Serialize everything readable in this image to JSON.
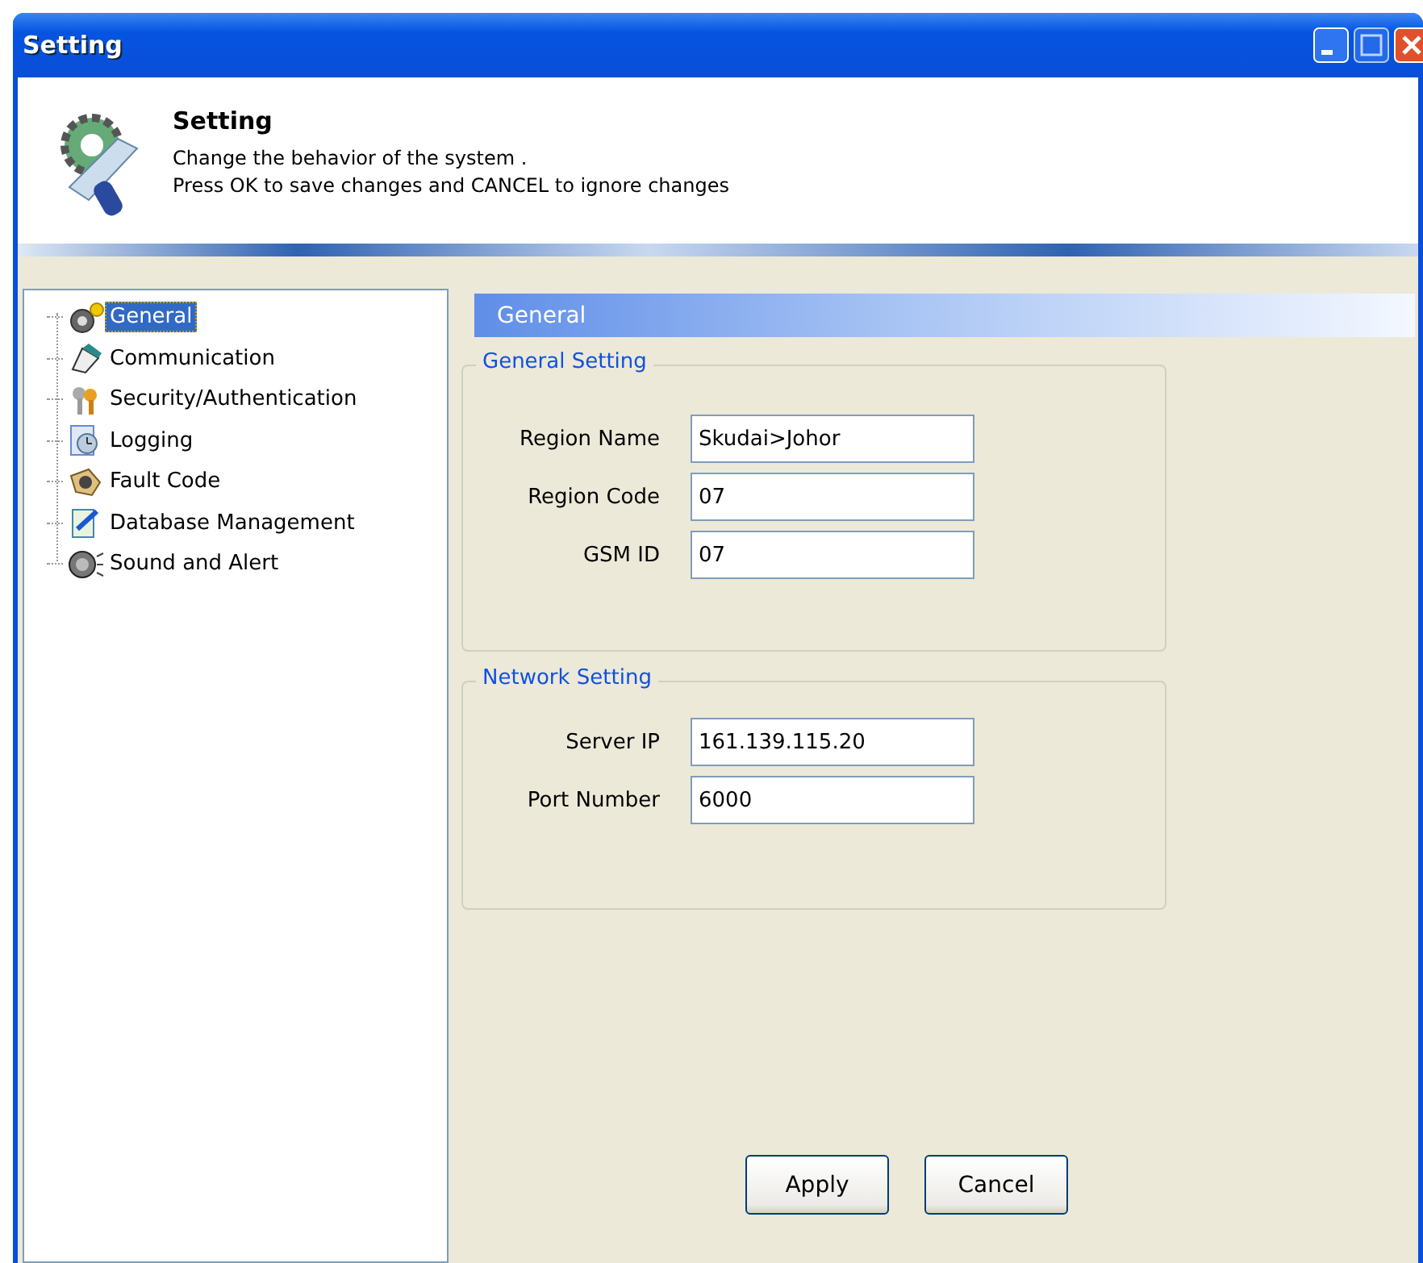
{
  "window": {
    "title": "Setting"
  },
  "header": {
    "title": "Setting",
    "lines": [
      "Change the behavior of the system .",
      "Press OK to save changes and CANCEL to ignore changes"
    ]
  },
  "tree": {
    "items": [
      {
        "label": "General",
        "selected": true
      },
      {
        "label": "Communication",
        "selected": false
      },
      {
        "label": "Security/Authentication",
        "selected": false
      },
      {
        "label": "Logging",
        "selected": false
      },
      {
        "label": "Fault Code",
        "selected": false
      },
      {
        "label": "Database Management",
        "selected": false
      },
      {
        "label": "Sound and Alert",
        "selected": false
      }
    ]
  },
  "panel": {
    "title": "General",
    "groups": [
      {
        "title": "General Setting",
        "fields": [
          {
            "label": "Region Name",
            "value": "Skudai>Johor"
          },
          {
            "label": "Region Code",
            "value": "07"
          },
          {
            "label": "GSM ID",
            "value": "07"
          }
        ]
      },
      {
        "title": "Network Setting",
        "fields": [
          {
            "label": "Server IP",
            "value": "161.139.115.20"
          },
          {
            "label": "Port Number",
            "value": "6000"
          }
        ]
      }
    ]
  },
  "buttons": [
    "Apply",
    "Cancel"
  ]
}
